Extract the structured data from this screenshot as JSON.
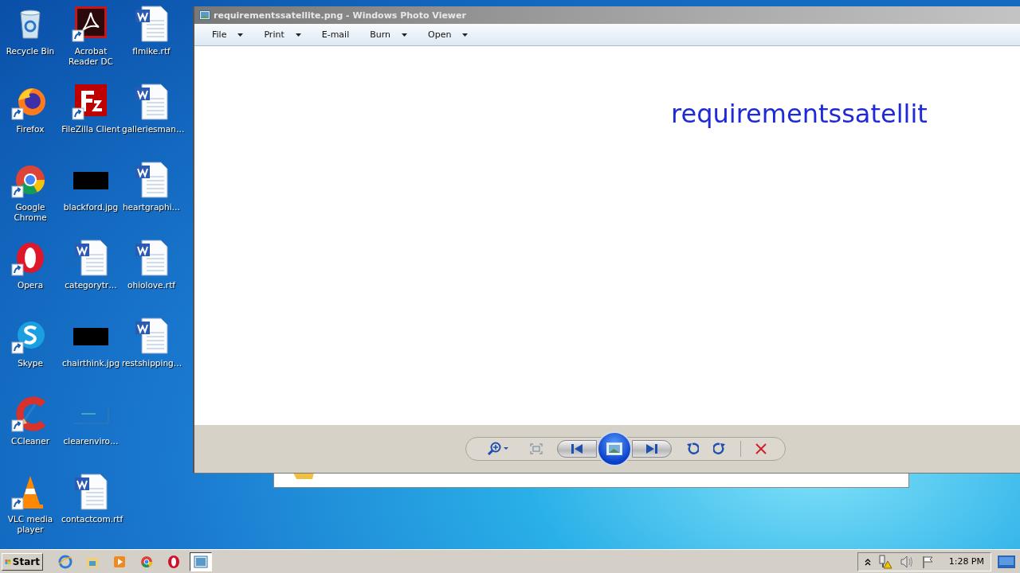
{
  "desktop": {
    "icons": [
      {
        "label": "Recycle Bin",
        "kind": "recycle",
        "shortcut": false
      },
      {
        "label": "Firefox",
        "kind": "firefox",
        "shortcut": true
      },
      {
        "label": "Google Chrome",
        "kind": "chrome",
        "shortcut": true
      },
      {
        "label": "Opera",
        "kind": "opera",
        "shortcut": true
      },
      {
        "label": "Skype",
        "kind": "skype",
        "shortcut": true
      },
      {
        "label": "CCleaner",
        "kind": "ccleaner",
        "shortcut": true
      },
      {
        "label": "VLC media player",
        "kind": "vlc",
        "shortcut": true
      },
      {
        "label": "Acrobat Reader DC",
        "kind": "acrobat",
        "shortcut": true
      },
      {
        "label": "FileZilla Client",
        "kind": "filezilla",
        "shortcut": true
      },
      {
        "label": "blackford.jpg",
        "kind": "dark-image",
        "shortcut": false
      },
      {
        "label": "categorytr…",
        "kind": "document",
        "shortcut": false
      },
      {
        "label": "chairthink.jpg",
        "kind": "dark-image",
        "shortcut": false
      },
      {
        "label": "clearenviro…",
        "kind": "light-image",
        "shortcut": false
      },
      {
        "label": "contactcom.rtf",
        "kind": "document",
        "shortcut": false
      },
      {
        "label": "flmike.rtf",
        "kind": "document",
        "shortcut": false
      },
      {
        "label": "galleriesman…",
        "kind": "document",
        "shortcut": false
      },
      {
        "label": "heartgraphi…",
        "kind": "document",
        "shortcut": false
      },
      {
        "label": "ohiolove.rtf",
        "kind": "document",
        "shortcut": false
      },
      {
        "label": "restshipping…",
        "kind": "document",
        "shortcut": false
      }
    ]
  },
  "window": {
    "title": "requirementssatellite.png - Windows Photo Viewer",
    "menu": [
      {
        "label": "File",
        "dropdown": true
      },
      {
        "label": "Print",
        "dropdown": true
      },
      {
        "label": "E-mail",
        "dropdown": false
      },
      {
        "label": "Burn",
        "dropdown": true
      },
      {
        "label": "Open",
        "dropdown": true
      }
    ],
    "image_text": "requirementssatellit"
  },
  "taskbar": {
    "start": "Start",
    "items": [
      {
        "kind": "ie",
        "selected": false
      },
      {
        "kind": "explorer",
        "selected": false
      },
      {
        "kind": "media",
        "selected": false
      },
      {
        "kind": "chrome",
        "selected": false
      },
      {
        "kind": "opera",
        "selected": false
      },
      {
        "kind": "photo",
        "selected": true
      }
    ],
    "clock": "1:28 PM"
  }
}
